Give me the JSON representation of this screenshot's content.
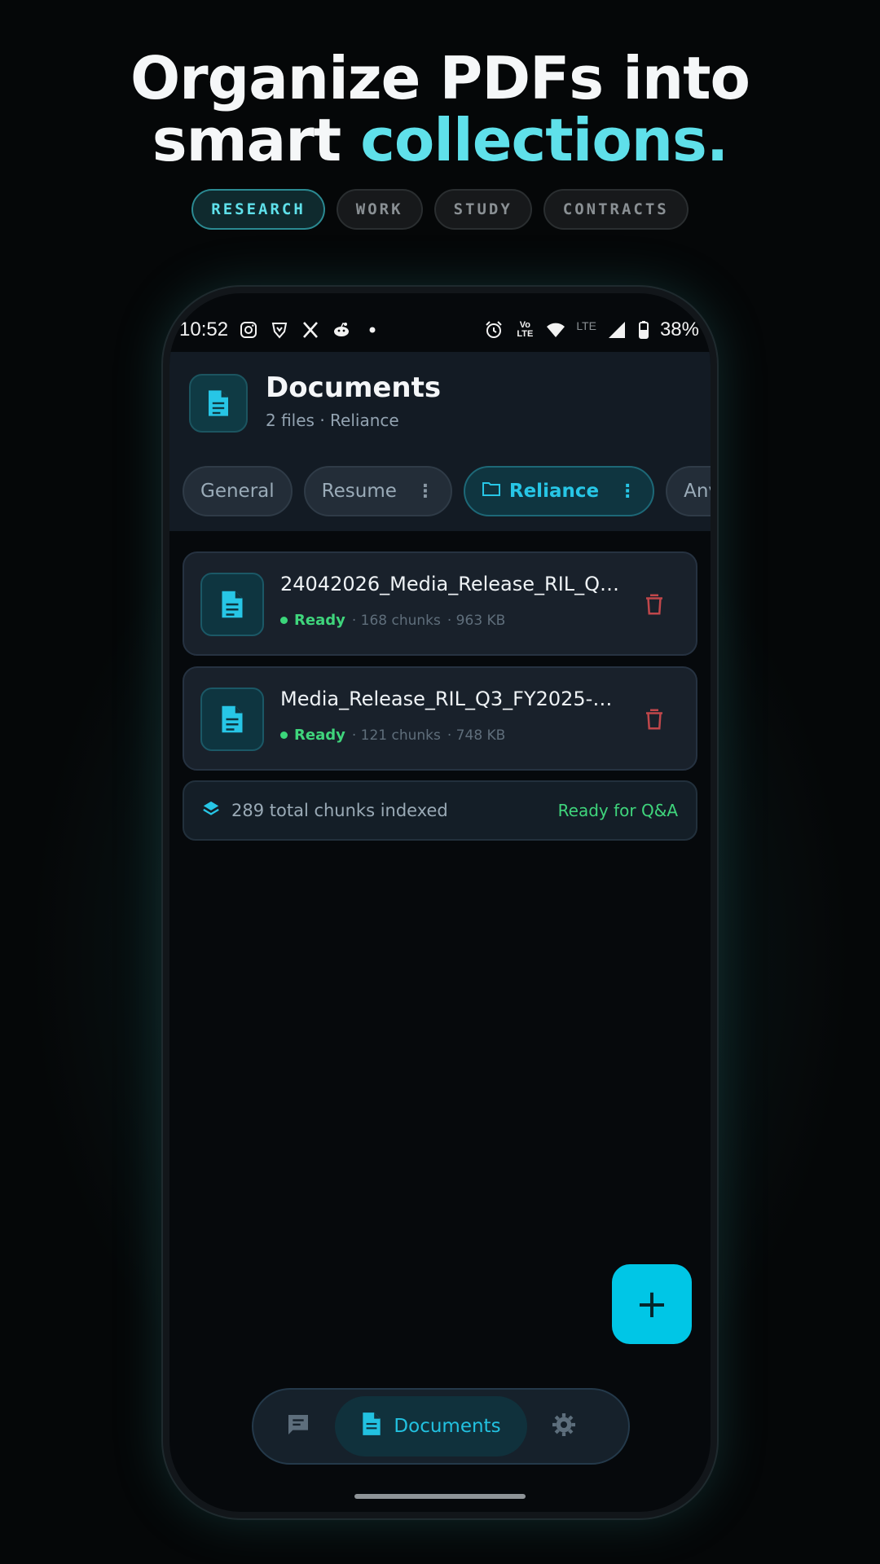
{
  "promo": {
    "headline_line1": "Organize PDFs into",
    "headline_line2_plain": "smart ",
    "headline_line2_accent": "collections.",
    "tags": [
      "RESEARCH",
      "WORK",
      "STUDY",
      "CONTRACTS"
    ],
    "active_tag": "RESEARCH"
  },
  "status_bar": {
    "time": "10:52",
    "network": "LTE",
    "battery": "38%",
    "left_icons": [
      "instagram-icon",
      "brave-icon",
      "x-icon",
      "reddit-icon",
      "dot-icon"
    ],
    "right_icons": [
      "alarm-icon",
      "volte-icon",
      "wifi-icon",
      "signal-icon",
      "battery-icon"
    ],
    "volte_label": "Vo LTE"
  },
  "header": {
    "title": "Documents",
    "subtitle": "2 files · Reliance",
    "icon": "document-icon"
  },
  "collections": [
    {
      "label": "General",
      "menu": false,
      "active": false
    },
    {
      "label": "Resume",
      "menu": true,
      "active": false
    },
    {
      "label": "Reliance",
      "menu": true,
      "active": true
    },
    {
      "label": "Anvit",
      "menu": true,
      "active": false
    }
  ],
  "files": [
    {
      "name": "24042026_Media_Release_RIL_Q…",
      "status": "Ready",
      "chunks": "· 168 chunks",
      "size": "· 963 KB"
    },
    {
      "name": "Media_Release_RIL_Q3_FY2025-2…",
      "status": "Ready",
      "chunks": "· 121 chunks",
      "size": "· 748 KB"
    }
  ],
  "summary": {
    "text": "289 total chunks indexed",
    "status": "Ready for Q&A"
  },
  "fab": {
    "label": "+"
  },
  "nav": {
    "chat_icon": "chat-icon",
    "documents_label": "Documents",
    "settings_icon": "gear-icon"
  },
  "colors": {
    "accent": "#5fe0ea",
    "primary": "#00c6e6",
    "ready": "#3fd57c",
    "danger": "#c0474b",
    "surface": "#19212b",
    "background": "#050708"
  }
}
